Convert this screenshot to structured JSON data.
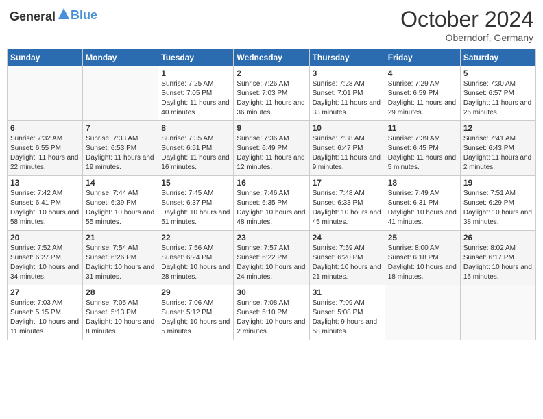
{
  "header": {
    "logo_general": "General",
    "logo_blue": "Blue",
    "month": "October 2024",
    "location": "Oberndorf, Germany"
  },
  "weekdays": [
    "Sunday",
    "Monday",
    "Tuesday",
    "Wednesday",
    "Thursday",
    "Friday",
    "Saturday"
  ],
  "weeks": [
    [
      {
        "day": "",
        "sunrise": "",
        "sunset": "",
        "daylight": "",
        "empty": true
      },
      {
        "day": "",
        "sunrise": "",
        "sunset": "",
        "daylight": "",
        "empty": true
      },
      {
        "day": "1",
        "sunrise": "Sunrise: 7:25 AM",
        "sunset": "Sunset: 7:05 PM",
        "daylight": "Daylight: 11 hours and 40 minutes.",
        "empty": false
      },
      {
        "day": "2",
        "sunrise": "Sunrise: 7:26 AM",
        "sunset": "Sunset: 7:03 PM",
        "daylight": "Daylight: 11 hours and 36 minutes.",
        "empty": false
      },
      {
        "day": "3",
        "sunrise": "Sunrise: 7:28 AM",
        "sunset": "Sunset: 7:01 PM",
        "daylight": "Daylight: 11 hours and 33 minutes.",
        "empty": false
      },
      {
        "day": "4",
        "sunrise": "Sunrise: 7:29 AM",
        "sunset": "Sunset: 6:59 PM",
        "daylight": "Daylight: 11 hours and 29 minutes.",
        "empty": false
      },
      {
        "day": "5",
        "sunrise": "Sunrise: 7:30 AM",
        "sunset": "Sunset: 6:57 PM",
        "daylight": "Daylight: 11 hours and 26 minutes.",
        "empty": false
      }
    ],
    [
      {
        "day": "6",
        "sunrise": "Sunrise: 7:32 AM",
        "sunset": "Sunset: 6:55 PM",
        "daylight": "Daylight: 11 hours and 22 minutes.",
        "empty": false
      },
      {
        "day": "7",
        "sunrise": "Sunrise: 7:33 AM",
        "sunset": "Sunset: 6:53 PM",
        "daylight": "Daylight: 11 hours and 19 minutes.",
        "empty": false
      },
      {
        "day": "8",
        "sunrise": "Sunrise: 7:35 AM",
        "sunset": "Sunset: 6:51 PM",
        "daylight": "Daylight: 11 hours and 16 minutes.",
        "empty": false
      },
      {
        "day": "9",
        "sunrise": "Sunrise: 7:36 AM",
        "sunset": "Sunset: 6:49 PM",
        "daylight": "Daylight: 11 hours and 12 minutes.",
        "empty": false
      },
      {
        "day": "10",
        "sunrise": "Sunrise: 7:38 AM",
        "sunset": "Sunset: 6:47 PM",
        "daylight": "Daylight: 11 hours and 9 minutes.",
        "empty": false
      },
      {
        "day": "11",
        "sunrise": "Sunrise: 7:39 AM",
        "sunset": "Sunset: 6:45 PM",
        "daylight": "Daylight: 11 hours and 5 minutes.",
        "empty": false
      },
      {
        "day": "12",
        "sunrise": "Sunrise: 7:41 AM",
        "sunset": "Sunset: 6:43 PM",
        "daylight": "Daylight: 11 hours and 2 minutes.",
        "empty": false
      }
    ],
    [
      {
        "day": "13",
        "sunrise": "Sunrise: 7:42 AM",
        "sunset": "Sunset: 6:41 PM",
        "daylight": "Daylight: 10 hours and 58 minutes.",
        "empty": false
      },
      {
        "day": "14",
        "sunrise": "Sunrise: 7:44 AM",
        "sunset": "Sunset: 6:39 PM",
        "daylight": "Daylight: 10 hours and 55 minutes.",
        "empty": false
      },
      {
        "day": "15",
        "sunrise": "Sunrise: 7:45 AM",
        "sunset": "Sunset: 6:37 PM",
        "daylight": "Daylight: 10 hours and 51 minutes.",
        "empty": false
      },
      {
        "day": "16",
        "sunrise": "Sunrise: 7:46 AM",
        "sunset": "Sunset: 6:35 PM",
        "daylight": "Daylight: 10 hours and 48 minutes.",
        "empty": false
      },
      {
        "day": "17",
        "sunrise": "Sunrise: 7:48 AM",
        "sunset": "Sunset: 6:33 PM",
        "daylight": "Daylight: 10 hours and 45 minutes.",
        "empty": false
      },
      {
        "day": "18",
        "sunrise": "Sunrise: 7:49 AM",
        "sunset": "Sunset: 6:31 PM",
        "daylight": "Daylight: 10 hours and 41 minutes.",
        "empty": false
      },
      {
        "day": "19",
        "sunrise": "Sunrise: 7:51 AM",
        "sunset": "Sunset: 6:29 PM",
        "daylight": "Daylight: 10 hours and 38 minutes.",
        "empty": false
      }
    ],
    [
      {
        "day": "20",
        "sunrise": "Sunrise: 7:52 AM",
        "sunset": "Sunset: 6:27 PM",
        "daylight": "Daylight: 10 hours and 34 minutes.",
        "empty": false
      },
      {
        "day": "21",
        "sunrise": "Sunrise: 7:54 AM",
        "sunset": "Sunset: 6:26 PM",
        "daylight": "Daylight: 10 hours and 31 minutes.",
        "empty": false
      },
      {
        "day": "22",
        "sunrise": "Sunrise: 7:56 AM",
        "sunset": "Sunset: 6:24 PM",
        "daylight": "Daylight: 10 hours and 28 minutes.",
        "empty": false
      },
      {
        "day": "23",
        "sunrise": "Sunrise: 7:57 AM",
        "sunset": "Sunset: 6:22 PM",
        "daylight": "Daylight: 10 hours and 24 minutes.",
        "empty": false
      },
      {
        "day": "24",
        "sunrise": "Sunrise: 7:59 AM",
        "sunset": "Sunset: 6:20 PM",
        "daylight": "Daylight: 10 hours and 21 minutes.",
        "empty": false
      },
      {
        "day": "25",
        "sunrise": "Sunrise: 8:00 AM",
        "sunset": "Sunset: 6:18 PM",
        "daylight": "Daylight: 10 hours and 18 minutes.",
        "empty": false
      },
      {
        "day": "26",
        "sunrise": "Sunrise: 8:02 AM",
        "sunset": "Sunset: 6:17 PM",
        "daylight": "Daylight: 10 hours and 15 minutes.",
        "empty": false
      }
    ],
    [
      {
        "day": "27",
        "sunrise": "Sunrise: 7:03 AM",
        "sunset": "Sunset: 5:15 PM",
        "daylight": "Daylight: 10 hours and 11 minutes.",
        "empty": false
      },
      {
        "day": "28",
        "sunrise": "Sunrise: 7:05 AM",
        "sunset": "Sunset: 5:13 PM",
        "daylight": "Daylight: 10 hours and 8 minutes.",
        "empty": false
      },
      {
        "day": "29",
        "sunrise": "Sunrise: 7:06 AM",
        "sunset": "Sunset: 5:12 PM",
        "daylight": "Daylight: 10 hours and 5 minutes.",
        "empty": false
      },
      {
        "day": "30",
        "sunrise": "Sunrise: 7:08 AM",
        "sunset": "Sunset: 5:10 PM",
        "daylight": "Daylight: 10 hours and 2 minutes.",
        "empty": false
      },
      {
        "day": "31",
        "sunrise": "Sunrise: 7:09 AM",
        "sunset": "Sunset: 5:08 PM",
        "daylight": "Daylight: 9 hours and 58 minutes.",
        "empty": false
      },
      {
        "day": "",
        "sunrise": "",
        "sunset": "",
        "daylight": "",
        "empty": true
      },
      {
        "day": "",
        "sunrise": "",
        "sunset": "",
        "daylight": "",
        "empty": true
      }
    ]
  ]
}
